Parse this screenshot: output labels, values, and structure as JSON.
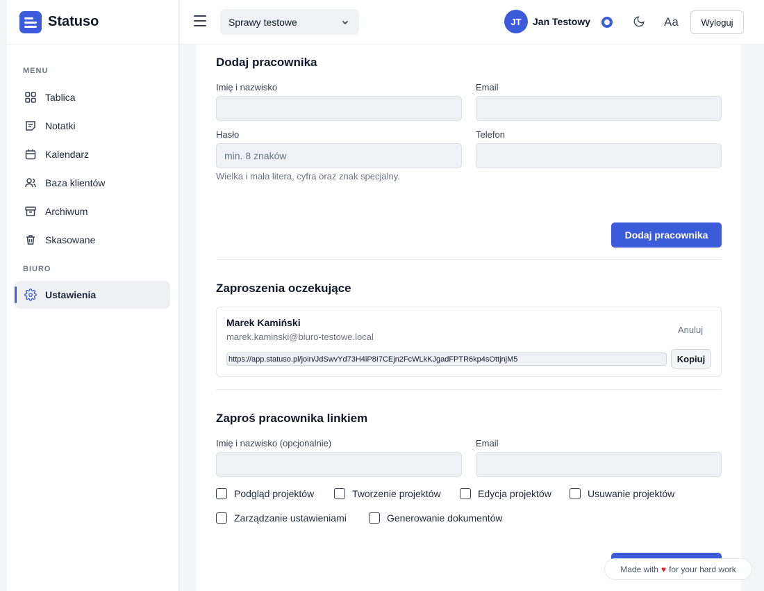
{
  "app": {
    "name": "Statuso"
  },
  "sidebar": {
    "menu_label": "MENU",
    "items": [
      {
        "label": "Tablica",
        "icon": "grid-icon"
      },
      {
        "label": "Notatki",
        "icon": "note-icon"
      },
      {
        "label": "Kalendarz",
        "icon": "calendar-icon"
      },
      {
        "label": "Baza klientów",
        "icon": "users-icon"
      },
      {
        "label": "Archiwum",
        "icon": "archive-icon"
      },
      {
        "label": "Skasowane",
        "icon": "trash-icon"
      }
    ],
    "office_label": "BIURO",
    "office_items": [
      {
        "label": "Ustawienia",
        "icon": "gear-icon",
        "active": true
      }
    ]
  },
  "topbar": {
    "case_select": "Sprawy testowe",
    "user_initials": "JT",
    "user_name": "Jan Testowy",
    "font_toggle": "Aa",
    "logout": "Wyloguj"
  },
  "add_employee": {
    "title": "Dodaj pracownika",
    "name_label": "Imię i nazwisko",
    "name_value": "",
    "email_label": "Email",
    "email_value": "",
    "password_label": "Hasło",
    "password_placeholder": "min. 8 znaków",
    "password_hint": "Wielka i mała litera, cyfra oraz znak specjalny.",
    "phone_label": "Telefon",
    "phone_value": "",
    "submit": "Dodaj pracownika"
  },
  "pending_invites": {
    "title": "Zaproszenia oczekujące",
    "items": [
      {
        "name": "Marek Kamiński",
        "email": "marek.kaminski@biuro-testowe.local",
        "cancel": "Anuluj",
        "link": "https://app.statuso.pl/join/JdSwvYd73H4iP8I7CEjn2FcWLkKJgadFPTR6kp4sOttjnjM5",
        "copy": "Kopiuj"
      }
    ]
  },
  "invite_link": {
    "title": "Zaproś pracownika linkiem",
    "name_label": "Imię i nazwisko (opcjonalnie)",
    "email_label": "Email",
    "permissions": [
      {
        "label": "Podgląd projektów",
        "checked": false
      },
      {
        "label": "Tworzenie projektów",
        "checked": false
      },
      {
        "label": "Edycja projektów",
        "checked": false
      },
      {
        "label": "Usuwanie projektów",
        "checked": false
      },
      {
        "label": "Zarządzanie ustawieniami",
        "checked": false
      },
      {
        "label": "Generowanie dokumentów",
        "checked": false
      }
    ]
  },
  "footer_badge": {
    "prefix": "Made with",
    "suffix": "for your hard work"
  },
  "colors": {
    "accent": "#3b5bdb",
    "heart": "#dc2626"
  }
}
